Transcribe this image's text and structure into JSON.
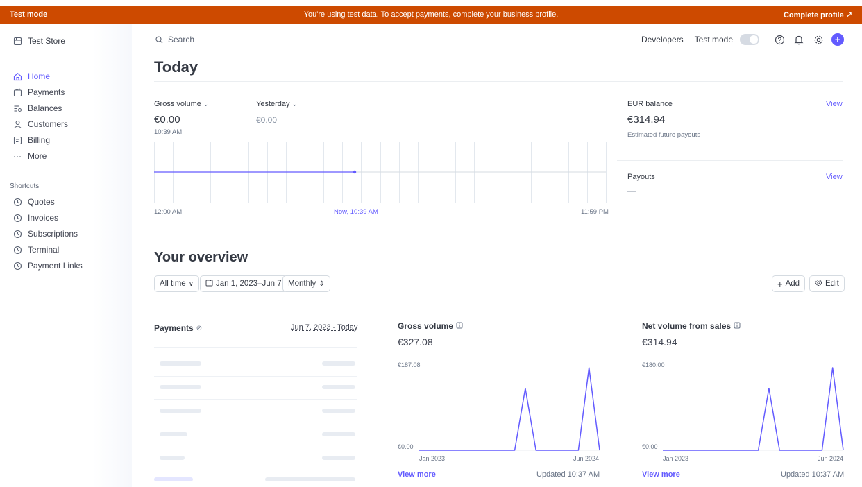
{
  "banner": {
    "left": "Test mode",
    "center": "You're using test data. To accept payments, complete your business profile.",
    "right": "Complete profile ↗"
  },
  "sidebar": {
    "store_name": "Test Store",
    "items": [
      {
        "label": "Home",
        "icon": "home-icon"
      },
      {
        "label": "Payments",
        "icon": "wallet-icon"
      },
      {
        "label": "Balances",
        "icon": "balance-icon"
      },
      {
        "label": "Customers",
        "icon": "user-icon"
      },
      {
        "label": "Billing",
        "icon": "billing-icon"
      },
      {
        "label": "More",
        "icon": "more-icon"
      }
    ],
    "shortcuts_heading": "Shortcuts",
    "shortcuts": [
      "Quotes",
      "Invoices",
      "Subscriptions",
      "Terminal",
      "Payment Links"
    ]
  },
  "topbar": {
    "search_placeholder": "Search",
    "developers": "Developers",
    "test_mode": "Test mode"
  },
  "today": {
    "heading": "Today",
    "gross_label": "Gross volume",
    "gross_value": "€0.00",
    "gross_time": "10:39 AM",
    "yesterday_label": "Yesterday",
    "yesterday_value": "€0.00",
    "x_start": "12:00 AM",
    "x_now": "Now, 10:39 AM",
    "x_end": "11:59 PM",
    "now_fraction": 0.444,
    "balance_label": "EUR balance",
    "balance_view": "View",
    "balance_value": "€314.94",
    "balance_sub": "Estimated future payouts",
    "payouts_label": "Payouts",
    "payouts_view": "View",
    "payouts_value": "—"
  },
  "overview": {
    "heading": "Your overview",
    "filter_range": "All time",
    "filter_dates": "Jan 1, 2023–Jun 7",
    "filter_interval": "Monthly",
    "add": "Add",
    "edit": "Edit",
    "payments_title": "Payments",
    "payments_range": "Jun 7, 2023 - Today",
    "gross_title": "Gross volume",
    "gross_value": "€327.08",
    "gross_y_max": "€187.08",
    "gross_y_min": "€0.00",
    "net_title": "Net volume from sales",
    "net_value": "€314.94",
    "net_y_max": "€180.00",
    "net_y_min": "€0.00",
    "x_start": "Jan 2023",
    "x_end": "Jun 2024",
    "view_more": "View more",
    "updated": "Updated 10:37 AM"
  },
  "chart_data": [
    {
      "type": "line",
      "title": "Gross volume",
      "x": [
        "Jan 2023",
        "Feb 2023",
        "Mar 2023",
        "Apr 2023",
        "May 2023",
        "Jun 2023",
        "Jul 2023",
        "Aug 2023",
        "Sep 2023",
        "Oct 2023",
        "Nov 2023",
        "Dec 2023",
        "Jan 2024",
        "Feb 2024",
        "Mar 2024",
        "Apr 2024",
        "May 2024",
        "Jun 2024"
      ],
      "values": [
        0,
        0,
        0,
        0,
        0,
        0,
        0,
        0,
        0,
        0,
        140,
        0,
        0,
        0,
        0,
        0,
        187.08,
        0
      ],
      "ylim": [
        0,
        187.08
      ]
    },
    {
      "type": "line",
      "title": "Net volume from sales",
      "x": [
        "Jan 2023",
        "Feb 2023",
        "Mar 2023",
        "Apr 2023",
        "May 2023",
        "Jun 2023",
        "Jul 2023",
        "Aug 2023",
        "Sep 2023",
        "Oct 2023",
        "Nov 2023",
        "Dec 2023",
        "Jan 2024",
        "Feb 2024",
        "Mar 2024",
        "Apr 2024",
        "May 2024",
        "Jun 2024"
      ],
      "values": [
        0,
        0,
        0,
        0,
        0,
        0,
        0,
        0,
        0,
        0,
        134.94,
        0,
        0,
        0,
        0,
        0,
        180,
        0
      ],
      "ylim": [
        0,
        180
      ]
    }
  ],
  "colors": {
    "accent": "#635bff",
    "banner": "#cd4a00"
  }
}
